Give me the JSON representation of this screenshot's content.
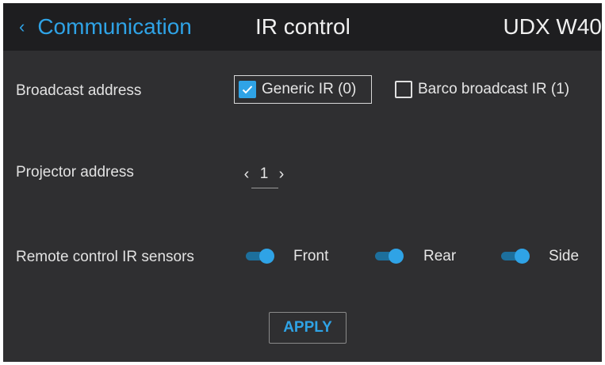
{
  "header": {
    "back_chevron": "‹",
    "back_label": "Communication",
    "title": "IR control",
    "device": "UDX W40"
  },
  "broadcast": {
    "label": "Broadcast address",
    "options": [
      {
        "label": "Generic IR (0)",
        "checked": true,
        "focused": true
      },
      {
        "label": "Barco broadcast IR (1)",
        "checked": false,
        "focused": false
      }
    ]
  },
  "projector_address": {
    "label": "Projector address",
    "value": "1",
    "decrement": "‹",
    "increment": "›"
  },
  "sensors": {
    "label": "Remote control IR sensors",
    "items": [
      {
        "label": "Front",
        "on": true
      },
      {
        "label": "Rear",
        "on": true
      },
      {
        "label": "Side",
        "on": true
      }
    ]
  },
  "apply_label": "APPLY",
  "colors": {
    "accent": "#2fa3e6",
    "background": "#2f2f31",
    "header": "#1e1e20"
  }
}
